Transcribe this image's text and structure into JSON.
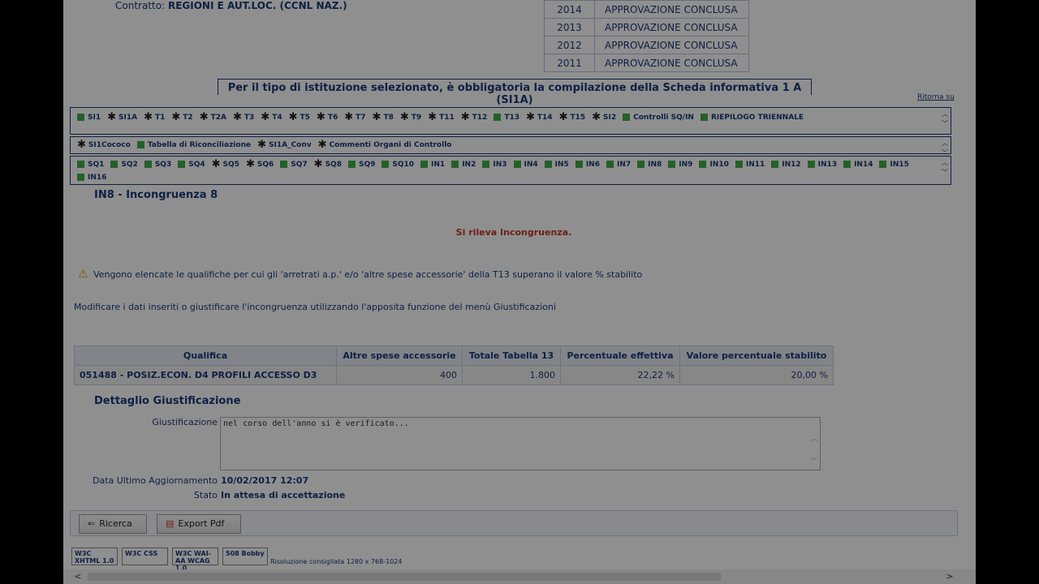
{
  "contratto": {
    "label": "Contratto:",
    "value": "REGIONI E AUT.LOC. (CCNL NAZ.)"
  },
  "years": [
    {
      "year": "2014",
      "status": "APPROVAZIONE CONCLUSA"
    },
    {
      "year": "2013",
      "status": "APPROVAZIONE CONCLUSA"
    },
    {
      "year": "2012",
      "status": "APPROVAZIONE CONCLUSA"
    },
    {
      "year": "2011",
      "status": "APPROVAZIONE CONCLUSA"
    }
  ],
  "notice": "Per il tipo di istituzione selezionato, è obbligatoria la compilazione della Scheda informativa 1 A (SI1A)",
  "ritorna": "Ritorna su",
  "tabs_row1": [
    {
      "label": "SI1",
      "icon": "green-square"
    },
    {
      "label": "SI1A",
      "icon": "star"
    },
    {
      "label": "T1",
      "icon": "star"
    },
    {
      "label": "T2",
      "icon": "star"
    },
    {
      "label": "T2A",
      "icon": "star"
    },
    {
      "label": "T3",
      "icon": "star"
    },
    {
      "label": "T4",
      "icon": "star"
    },
    {
      "label": "T5",
      "icon": "star"
    },
    {
      "label": "T6",
      "icon": "star"
    },
    {
      "label": "T7",
      "icon": "star"
    },
    {
      "label": "T8",
      "icon": "star"
    },
    {
      "label": "T9",
      "icon": "star"
    },
    {
      "label": "T11",
      "icon": "star"
    },
    {
      "label": "T12",
      "icon": "star"
    },
    {
      "label": "T13",
      "icon": "green-square"
    },
    {
      "label": "T14",
      "icon": "star"
    },
    {
      "label": "T15",
      "icon": "star"
    },
    {
      "label": "SI2",
      "icon": "star"
    },
    {
      "label": "Controlli SQ/IN",
      "icon": "green-square"
    },
    {
      "label": "RIEPILOGO TRIENNALE",
      "icon": "green-square"
    }
  ],
  "tabs_row2": [
    {
      "label": "SI1Cococo",
      "icon": "star"
    },
    {
      "label": "Tabella di Riconciliazione",
      "icon": "green-square"
    },
    {
      "label": "SI1A_Conv",
      "icon": "star"
    },
    {
      "label": "Commenti Organi di Controllo",
      "icon": "star"
    }
  ],
  "tabs_row3": [
    {
      "label": "SQ1",
      "icon": "green-square"
    },
    {
      "label": "SQ2",
      "icon": "green-square"
    },
    {
      "label": "SQ3",
      "icon": "green-square"
    },
    {
      "label": "SQ4",
      "icon": "green-square"
    },
    {
      "label": "SQ5",
      "icon": "star"
    },
    {
      "label": "SQ6",
      "icon": "star"
    },
    {
      "label": "SQ7",
      "icon": "green-square"
    },
    {
      "label": "SQ8",
      "icon": "star"
    },
    {
      "label": "SQ9",
      "icon": "green-square"
    },
    {
      "label": "SQ10",
      "icon": "green-square"
    },
    {
      "label": "IN1",
      "icon": "green-square"
    },
    {
      "label": "IN2",
      "icon": "green-square"
    },
    {
      "label": "IN3",
      "icon": "green-square"
    },
    {
      "label": "IN4",
      "icon": "green-square"
    },
    {
      "label": "IN5",
      "icon": "green-square"
    },
    {
      "label": "IN6",
      "icon": "green-square"
    },
    {
      "label": "IN7",
      "icon": "green-square"
    },
    {
      "label": "IN8",
      "icon": "green-square"
    },
    {
      "label": "IN9",
      "icon": "green-square"
    },
    {
      "label": "IN10",
      "icon": "green-square"
    },
    {
      "label": "IN11",
      "icon": "green-square"
    },
    {
      "label": "IN12",
      "icon": "green-square"
    },
    {
      "label": "IN13",
      "icon": "green-square"
    },
    {
      "label": "IN14",
      "icon": "green-square"
    },
    {
      "label": "IN15",
      "icon": "green-square"
    },
    {
      "label": "IN16",
      "icon": "green-square"
    }
  ],
  "section_title": "IN8 - Incongruenza 8",
  "rileva": "Si rileva Incongruenza.",
  "warning": "Vengono elencate le qualifiche per cui gli 'arretrati a.p.' e/o 'altre spese accessorie' della T13 superano il valore % stabilito",
  "modifica": "Modificare i dati inseriti o giustificare l'incongruenza utilizzando l'apposita funzione del menù Giustificazioni",
  "table": {
    "headers": [
      "Qualifica",
      "Altre spese accessorie",
      "Totale Tabella 13",
      "Percentuale effettiva",
      "Valore percentuale stabilito"
    ],
    "rows": [
      [
        "051488 - POSIZ.ECON. D4 PROFILI ACCESSO D3",
        "400",
        "1.800",
        "22,22 %",
        "20,00 %"
      ]
    ]
  },
  "dettaglio": {
    "title": "Dettaglio Giustificazione",
    "giust_label": "Giustificazione",
    "giust_value": "nel corso dell'anno si è verificato...",
    "data_label": "Data Ultimo Aggiornamento",
    "data_value": "10/02/2017 12:07",
    "stato_label": "Stato",
    "stato_value": "In attesa di accettazione"
  },
  "buttons": {
    "ricerca": "Ricerca",
    "export": "Export Pdf"
  },
  "badges": [
    "W3C XHTML 1.0",
    "W3C CSS",
    "W3C WAI-AA WCAG 1.0",
    "508 Bobby"
  ],
  "risoluzione": "Risoluzione consigliata 1280 x 768-1024",
  "colors": {
    "accent": "#1a3a7a",
    "ok": "#3fae49",
    "error": "#c0392b"
  }
}
